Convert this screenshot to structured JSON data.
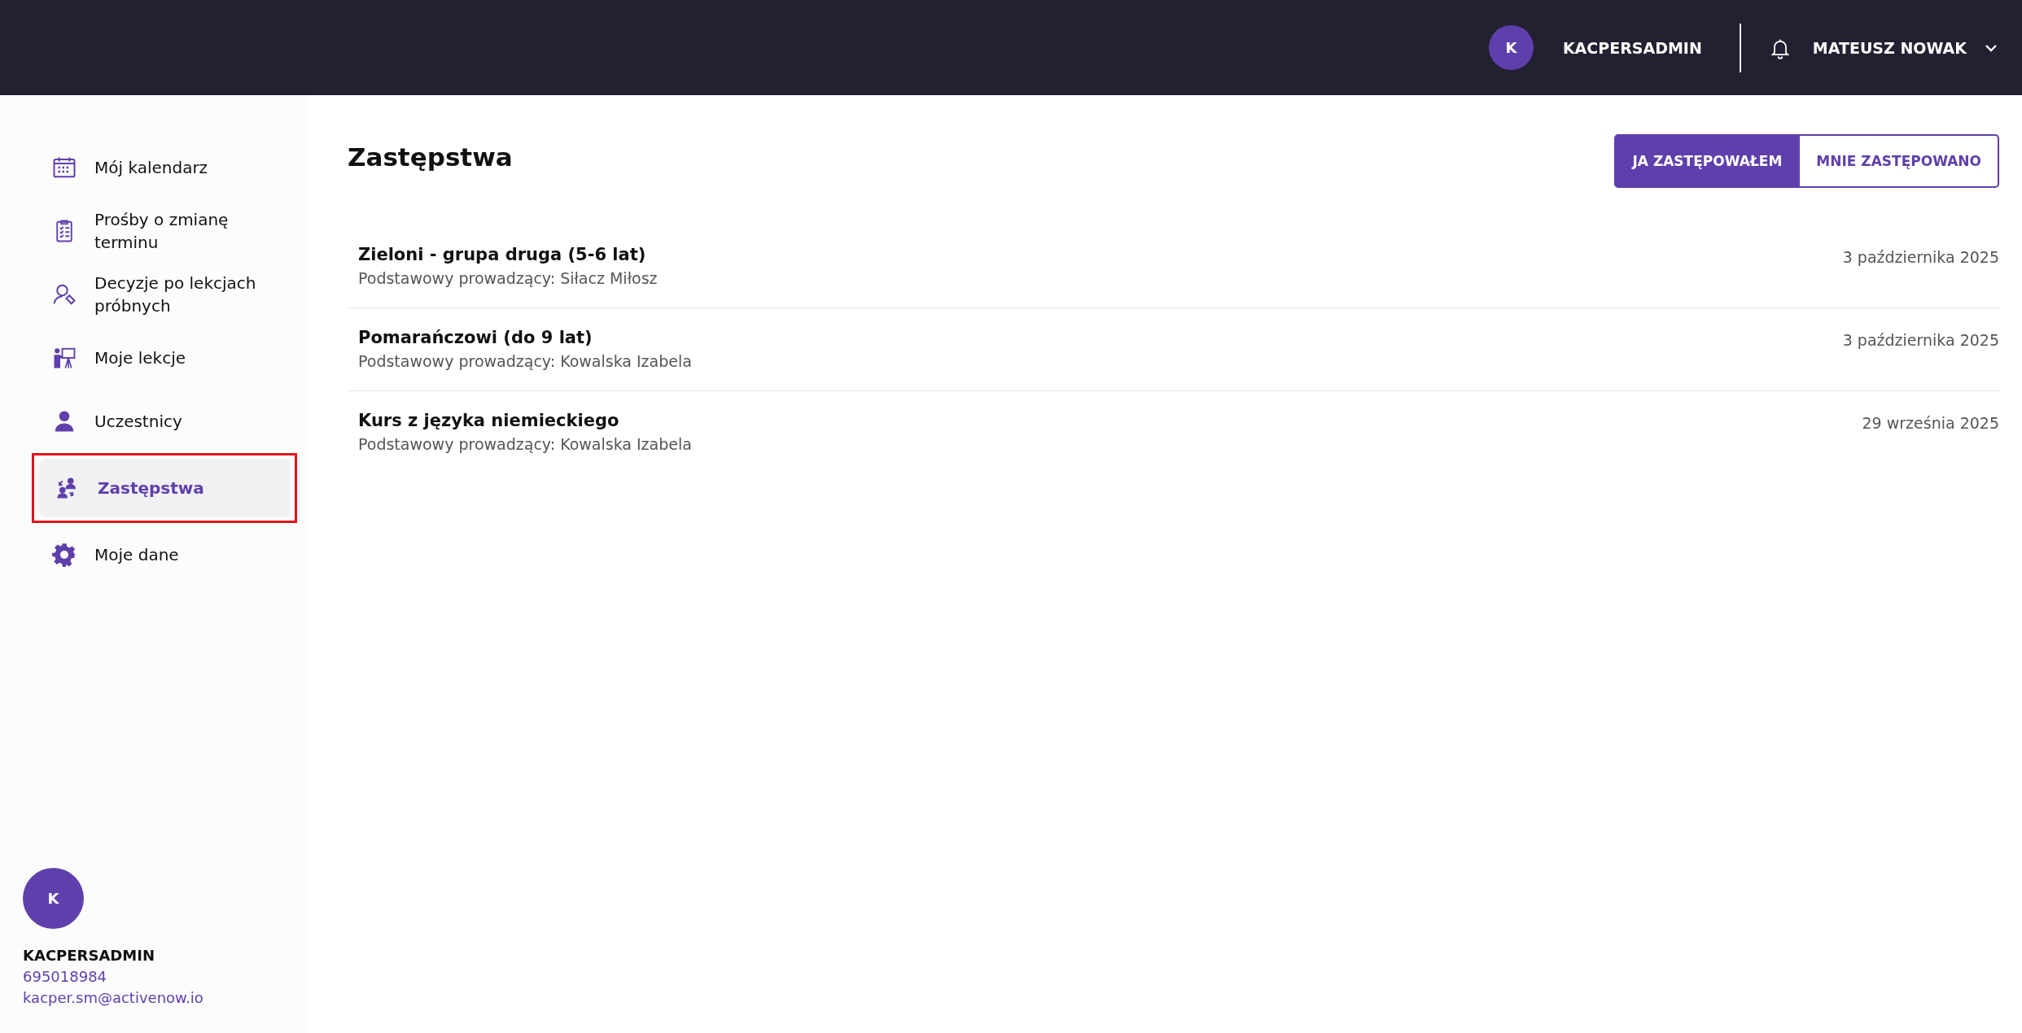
{
  "header": {
    "avatar_letter": "K",
    "account": "KACPERSADMIN",
    "user": "MATEUSZ NOWAK"
  },
  "sidebar": {
    "items": [
      {
        "label": "Mój kalendarz",
        "selected": false
      },
      {
        "label": "Prośby o zmianę terminu",
        "selected": false
      },
      {
        "label": "Decyzje po lekcjach próbnych",
        "selected": false
      },
      {
        "label": "Moje lekcje",
        "selected": false
      },
      {
        "label": "Uczestnicy",
        "selected": false
      },
      {
        "label": "Zastępstwa",
        "selected": true
      },
      {
        "label": "Moje dane",
        "selected": false
      }
    ],
    "profile": {
      "avatar_letter": "K",
      "name": "KACPERSADMIN",
      "phone": "695018984",
      "email": "kacper.sm@activenow.io"
    }
  },
  "page": {
    "title": "Zastępstwa",
    "toggle": [
      {
        "label": "JA ZASTĘPOWAŁEM",
        "selected": true
      },
      {
        "label": "MNIE ZASTĘPOWANO",
        "selected": false
      }
    ],
    "rows": [
      {
        "title": "Zieloni - grupa druga (5-6 lat)",
        "subtitle": "Podstawowy prowadzący: Siłacz Miłosz",
        "date": "3 października 2025"
      },
      {
        "title": "Pomarańczowi (do 9 lat)",
        "subtitle": "Podstawowy prowadzący: Kowalska Izabela",
        "date": "3 października 2025"
      },
      {
        "title": "Kurs z języka niemieckiego",
        "subtitle": "Podstawowy prowadzący: Kowalska Izabela",
        "date": "29 września 2025"
      }
    ]
  }
}
